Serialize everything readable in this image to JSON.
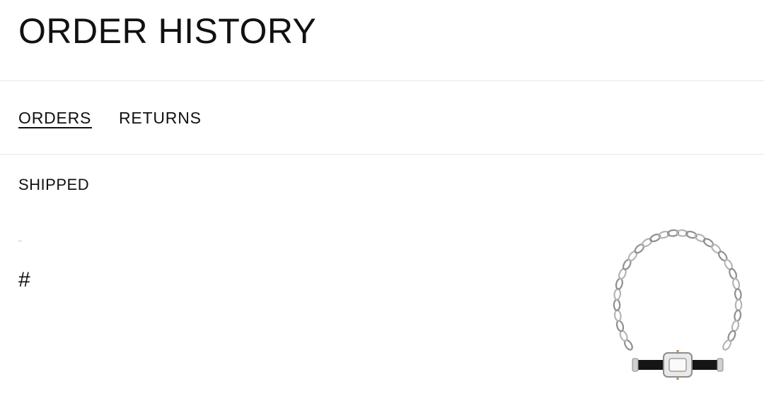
{
  "header": {
    "title": "ORDER HISTORY"
  },
  "tabs": [
    {
      "label": "ORDERS",
      "active": true
    },
    {
      "label": "RETURNS",
      "active": false
    }
  ],
  "order": {
    "status": "SHIPPED",
    "number_prefix": "#",
    "product_image": "chain-necklace-with-buckle"
  },
  "colors": {
    "text": "#111111",
    "divider": "#e6e6e6",
    "background": "#ffffff",
    "chain_silver": "#9a9a9a",
    "strap_black": "#151515"
  }
}
